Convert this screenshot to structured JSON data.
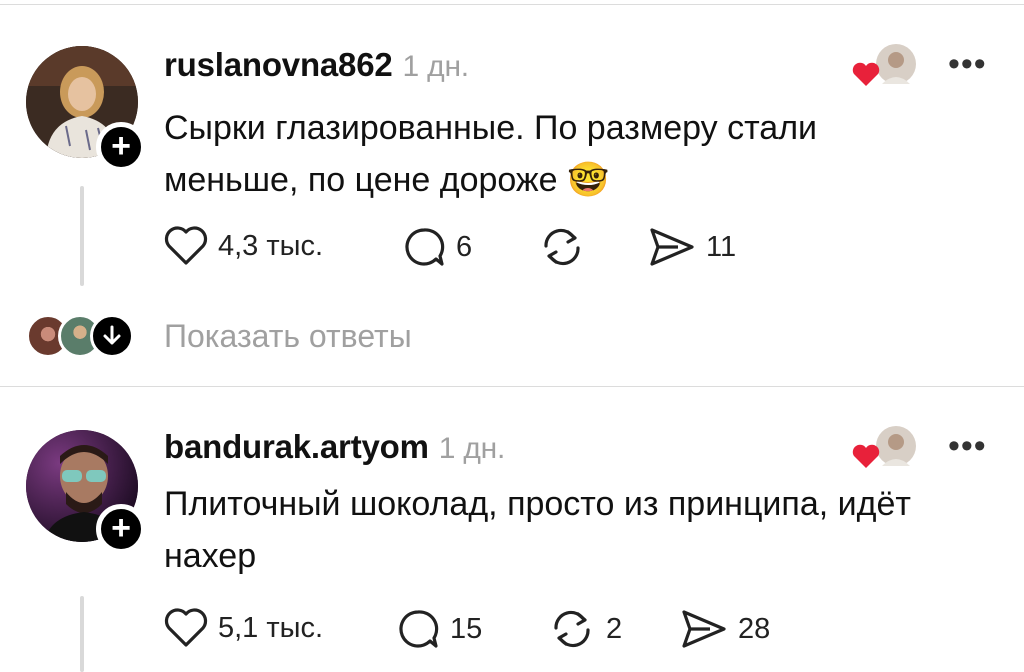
{
  "comments": [
    {
      "username": "ruslanovna862",
      "time": "1 дн.",
      "text_line1": "Сырки глазированные. По размеру стали",
      "text_line2": "меньше, по цене дороже",
      "emoji": "🤓",
      "likes": "4,3 тыс.",
      "replies": "6",
      "reposts": "",
      "shares": "11"
    },
    {
      "username": "bandurak.artyom",
      "time": "1 дн.",
      "text_line1": "Плиточный шоколад, просто из принципа, идёт",
      "text_line2": "нахер",
      "likes": "5,1 тыс.",
      "replies": "15",
      "reposts": "2",
      "shares": "28"
    }
  ],
  "show_replies_label": "Показать ответы",
  "colors": {
    "heart_red": "#e8213a",
    "muted_text": "#a0a0a0",
    "divider": "#dcdcdc"
  },
  "icons": [
    "plus-icon",
    "heart-icon",
    "comment-icon",
    "repost-icon",
    "share-icon",
    "more-icon",
    "arrow-down-icon"
  ]
}
